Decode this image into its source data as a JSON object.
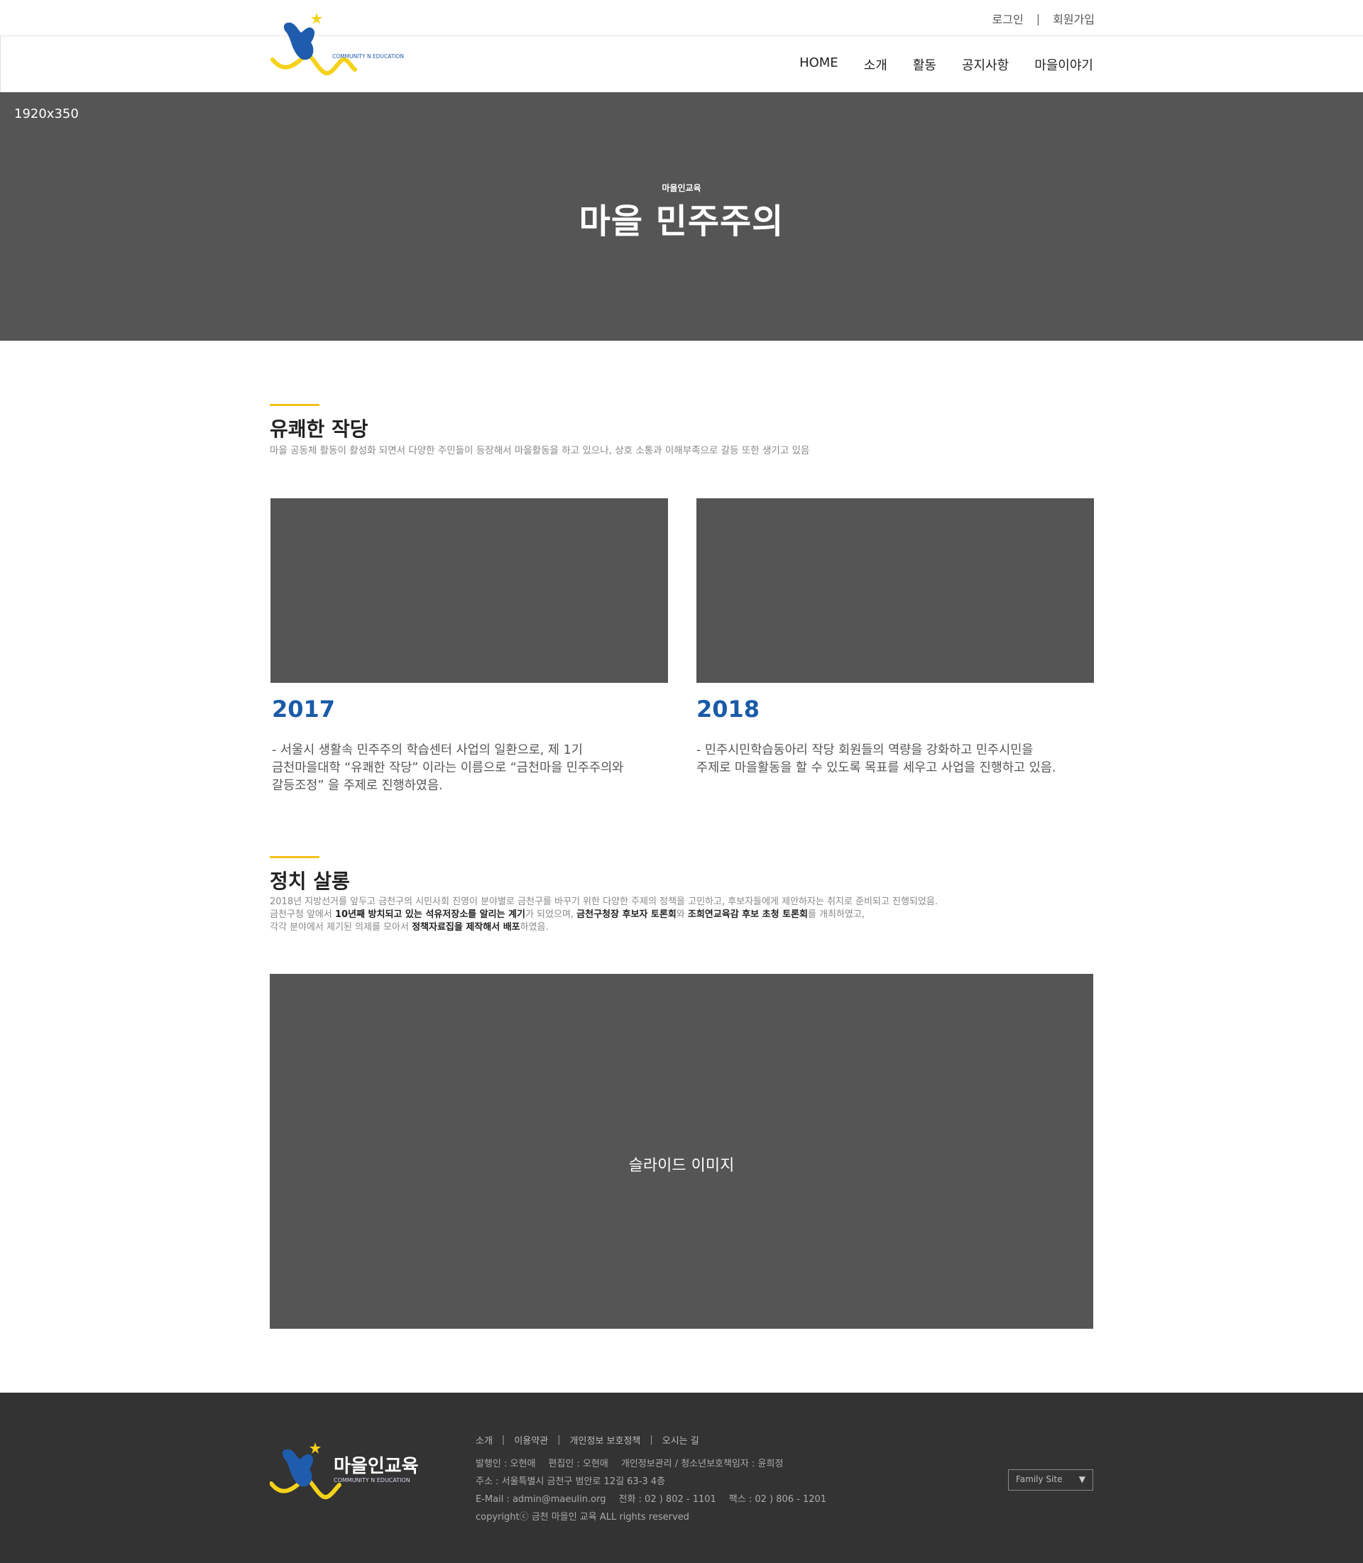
{
  "header": {
    "logo_subtitle": "COMMUNITY N EDUCATION",
    "login": "로그인",
    "separator": "|",
    "signup": "회원가입",
    "nav": [
      "HOME",
      "소개",
      "활동",
      "공지사항",
      "마을이야기"
    ]
  },
  "hero": {
    "size_label": "1920x350",
    "subtitle": "마을인교육",
    "title": "마을 민주주의"
  },
  "section1": {
    "title": "유쾌한 작당",
    "desc": "마을 공동체 활동이 활성화 되면서 다양한 주민들이 등장해서 마을활동을 하고 있으나, 상호 소통과 이해부족으로 갈등 또한 생기고 있음",
    "cards": [
      {
        "year": "2017",
        "lines": [
          "- 서울시 생활속 민주주의 학습센터 사업의 일환으로, 제 1기",
          "금천마을대학 “유쾌한 작당” 이라는 이름으로 “금천마을 민주주의와",
          "갈등조정” 을 주제로 진행하였음."
        ]
      },
      {
        "year": "2018",
        "lines": [
          "- 민주시민학습동아리 작당 회원들의 역량을 강화하고 민주시민을",
          "주제로 마을활동을 할 수 있도록 목표를 세우고 사업을 진행하고 있음."
        ]
      }
    ]
  },
  "section2": {
    "title": "정치 살롱",
    "line1": "2018년 지방선거를 앞두고 금천구의 시민사회 진영이 분야별로 금천구를 바꾸기 위한 다양한 주제의 정책을 고민하고, 후보자들에게 제안하자는 취지로 준비되고 진행되었음.",
    "line2_a": "금천구청 앞에서 ",
    "line2_b": "10년째 방치되고 있는 석유저장소를 알리는 계기",
    "line2_c": "가 되었으며, ",
    "line2_d": "금천구청장 후보자 토론회",
    "line2_e": "와 ",
    "line2_f": "조희연교육감 후보 초청 토론회",
    "line2_g": "를 개최하였고,",
    "line3_a": "각각 분야에서 제기된 의제를 모아서 ",
    "line3_b": "정책자료집을 제작해서 배포",
    "line3_c": "하였음.",
    "slide_label": "슬라이드 이미지"
  },
  "footer": {
    "logo_title": "마을인교육",
    "logo_subtitle": "COMMUNITY N EDUCATION",
    "links": [
      "소개",
      "이용약관",
      "개인정보 보호정책",
      "오시는 길"
    ],
    "separator": "|",
    "info_row1": [
      "발행인 : 오현애",
      "편집인 : 오현애",
      "개인정보관리 / 청소년보호책임자 : 윤희정"
    ],
    "info_row2": "주소 : 서울특별시 금천구 범안로 12길 63-3 4층",
    "info_row3": [
      "E-Mail : admin@maeulin.org",
      "전화 : 02 ) 802 - 1101",
      "팩스 : 02 ) 806 - 1201"
    ],
    "copyright": "copyrightⓒ 금천 마을인 교육 ALL rights reserved",
    "family_site": "Family Site",
    "family_arrow": "▼"
  },
  "colors": {
    "accent_yellow": "#f2c21b",
    "year_blue": "#1a5aa8",
    "placeholder_gray": "#555555",
    "footer_bg": "#333333"
  }
}
